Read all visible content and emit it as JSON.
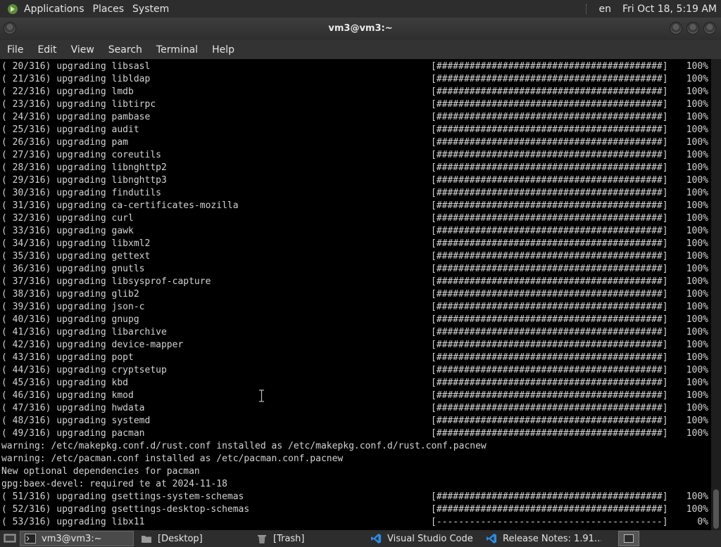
{
  "top_panel": {
    "menus": [
      "Applications",
      "Places",
      "System"
    ],
    "lang": "en",
    "clock": "Fri Oct 18,  5:19 AM"
  },
  "window": {
    "title": "vm3@vm3:~"
  },
  "menubar": [
    "File",
    "Edit",
    "View",
    "Search",
    "Terminal",
    "Help"
  ],
  "terminal": {
    "lines": [
      {
        "text": "( 20/316) upgrading libsasl",
        "bar": "[#########################################]",
        "pct": "100%"
      },
      {
        "text": "( 21/316) upgrading libldap",
        "bar": "[#########################################]",
        "pct": "100%"
      },
      {
        "text": "( 22/316) upgrading lmdb",
        "bar": "[#########################################]",
        "pct": "100%"
      },
      {
        "text": "( 23/316) upgrading libtirpc",
        "bar": "[#########################################]",
        "pct": "100%"
      },
      {
        "text": "( 24/316) upgrading pambase",
        "bar": "[#########################################]",
        "pct": "100%"
      },
      {
        "text": "( 25/316) upgrading audit",
        "bar": "[#########################################]",
        "pct": "100%"
      },
      {
        "text": "( 26/316) upgrading pam",
        "bar": "[#########################################]",
        "pct": "100%"
      },
      {
        "text": "( 27/316) upgrading coreutils",
        "bar": "[#########################################]",
        "pct": "100%"
      },
      {
        "text": "( 28/316) upgrading libnghttp2",
        "bar": "[#########################################]",
        "pct": "100%"
      },
      {
        "text": "( 29/316) upgrading libnghttp3",
        "bar": "[#########################################]",
        "pct": "100%"
      },
      {
        "text": "( 30/316) upgrading findutils",
        "bar": "[#########################################]",
        "pct": "100%"
      },
      {
        "text": "( 31/316) upgrading ca-certificates-mozilla",
        "bar": "[#########################################]",
        "pct": "100%"
      },
      {
        "text": "( 32/316) upgrading curl",
        "bar": "[#########################################]",
        "pct": "100%"
      },
      {
        "text": "( 33/316) upgrading gawk",
        "bar": "[#########################################]",
        "pct": "100%"
      },
      {
        "text": "( 34/316) upgrading libxml2",
        "bar": "[#########################################]",
        "pct": "100%"
      },
      {
        "text": "( 35/316) upgrading gettext",
        "bar": "[#########################################]",
        "pct": "100%"
      },
      {
        "text": "( 36/316) upgrading gnutls",
        "bar": "[#########################################]",
        "pct": "100%"
      },
      {
        "text": "( 37/316) upgrading libsysprof-capture",
        "bar": "[#########################################]",
        "pct": "100%"
      },
      {
        "text": "( 38/316) upgrading glib2",
        "bar": "[#########################################]",
        "pct": "100%"
      },
      {
        "text": "( 39/316) upgrading json-c",
        "bar": "[#########################################]",
        "pct": "100%"
      },
      {
        "text": "( 40/316) upgrading gnupg",
        "bar": "[#########################################]",
        "pct": "100%"
      },
      {
        "text": "( 41/316) upgrading libarchive",
        "bar": "[#########################################]",
        "pct": "100%"
      },
      {
        "text": "( 42/316) upgrading device-mapper",
        "bar": "[#########################################]",
        "pct": "100%"
      },
      {
        "text": "( 43/316) upgrading popt",
        "bar": "[#########################################]",
        "pct": "100%"
      },
      {
        "text": "( 44/316) upgrading cryptsetup",
        "bar": "[#########################################]",
        "pct": "100%"
      },
      {
        "text": "( 45/316) upgrading kbd",
        "bar": "[#########################################]",
        "pct": "100%"
      },
      {
        "text": "( 46/316) upgrading kmod",
        "bar": "[#########################################]",
        "pct": "100%"
      },
      {
        "text": "( 47/316) upgrading hwdata",
        "bar": "[#########################################]",
        "pct": "100%"
      },
      {
        "text": "( 48/316) upgrading systemd",
        "bar": "[#########################################]",
        "pct": "100%"
      },
      {
        "text": "( 49/316) upgrading pacman",
        "bar": "[#########################################]",
        "pct": "100%"
      },
      {
        "text": "warning: /etc/makepkg.conf.d/rust.conf installed as /etc/makepkg.conf.d/rust.conf.pacnew",
        "bar": "",
        "pct": ""
      },
      {
        "text": "warning: /etc/pacman.conf installed as /etc/pacman.conf.pacnew",
        "bar": "",
        "pct": ""
      },
      {
        "text": "New optional dependencies for pacman",
        "bar": "",
        "pct": ""
      },
      {
        "text": "gpg:baex-devel: required te at 2024-11-18",
        "bar": "",
        "pct": ""
      },
      {
        "text": "( 51/316) upgrading gsettings-system-schemas",
        "bar": "[#########################################]",
        "pct": "100%"
      },
      {
        "text": "( 52/316) upgrading gsettings-desktop-schemas",
        "bar": "[#########################################]",
        "pct": "100%"
      },
      {
        "text": "( 53/316) upgrading libx11",
        "bar": "[-----------------------------------------]",
        "pct": "0%"
      }
    ]
  },
  "taskbar": {
    "tasks": [
      {
        "label": "vm3@vm3:~",
        "icon": "terminal-icon",
        "active": true
      },
      {
        "label": "[Desktop]",
        "icon": "folder-icon",
        "active": false
      },
      {
        "label": "[Trash]",
        "icon": "trash-icon",
        "active": false
      },
      {
        "label": "Visual Studio Code",
        "icon": "vscode-icon",
        "active": false
      },
      {
        "label": "Release Notes: 1.91....",
        "icon": "vscode-icon",
        "active": false
      }
    ]
  },
  "colors": {
    "panel": "#2d2d2d",
    "terminal_bg": "#000000",
    "terminal_fg": "#d3d3d3",
    "vscode_blue": "#2a8ee6"
  }
}
